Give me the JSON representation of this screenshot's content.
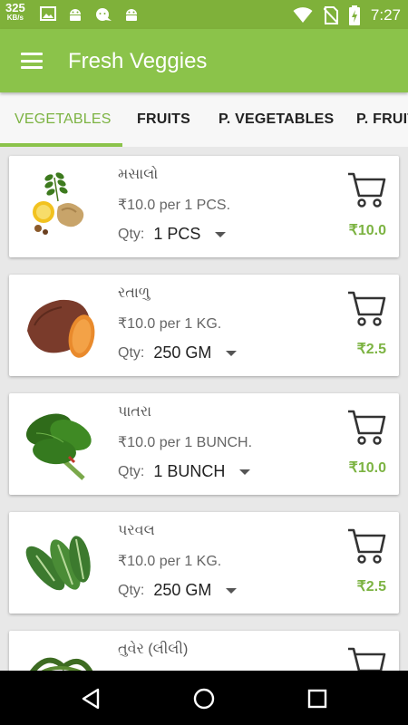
{
  "status_bar": {
    "speed": "325",
    "speed_unit": "KB/s",
    "time": "7:27",
    "icons": [
      "image-icon",
      "android-icon",
      "android-chat-icon",
      "android-icon",
      "wifi-icon",
      "no-sim-icon",
      "battery-charging-icon"
    ]
  },
  "app_bar": {
    "title": "Fresh Veggies",
    "menu_icon": "hamburger-menu-icon"
  },
  "tabs": [
    {
      "label": "VEGETABLES",
      "active": true
    },
    {
      "label": "FRUITS",
      "active": false
    },
    {
      "label": "P. VEGETABLES",
      "active": false
    },
    {
      "label": "P. FRUITS",
      "active": false
    }
  ],
  "products": [
    {
      "name": "મસાલો",
      "price": "₹10.0 per 1 PCS.",
      "qty_label": "Qty:",
      "qty": "1 PCS",
      "total": "₹10.0",
      "image": "spices-ginger-lemon-curry-leaves"
    },
    {
      "name": "રતાળુ",
      "price": "₹10.0 per 1 KG.",
      "qty_label": "Qty:",
      "qty": "250 GM",
      "total": "₹2.5",
      "image": "sweet-potato"
    },
    {
      "name": "પાતરા",
      "price": "₹10.0 per 1 BUNCH.",
      "qty_label": "Qty:",
      "qty": "1 BUNCH",
      "total": "₹10.0",
      "image": "colocasia-leaves-bunch"
    },
    {
      "name": "પરવલ",
      "price": "₹10.0 per 1 KG.",
      "qty_label": "Qty:",
      "qty": "250 GM",
      "total": "₹2.5",
      "image": "pointed-gourd"
    },
    {
      "name": "તુવેર (લીલી)",
      "price": "",
      "qty_label": "",
      "qty": "",
      "total": "",
      "image": "green-pigeon-peas"
    }
  ],
  "colors": {
    "status_bar": "#7fb13a",
    "app_bar": "#8bc34a",
    "accent": "#7cb342",
    "nav_bar": "#000000"
  },
  "nav_bar": {
    "buttons": [
      "back-icon",
      "home-icon",
      "recents-icon"
    ]
  }
}
